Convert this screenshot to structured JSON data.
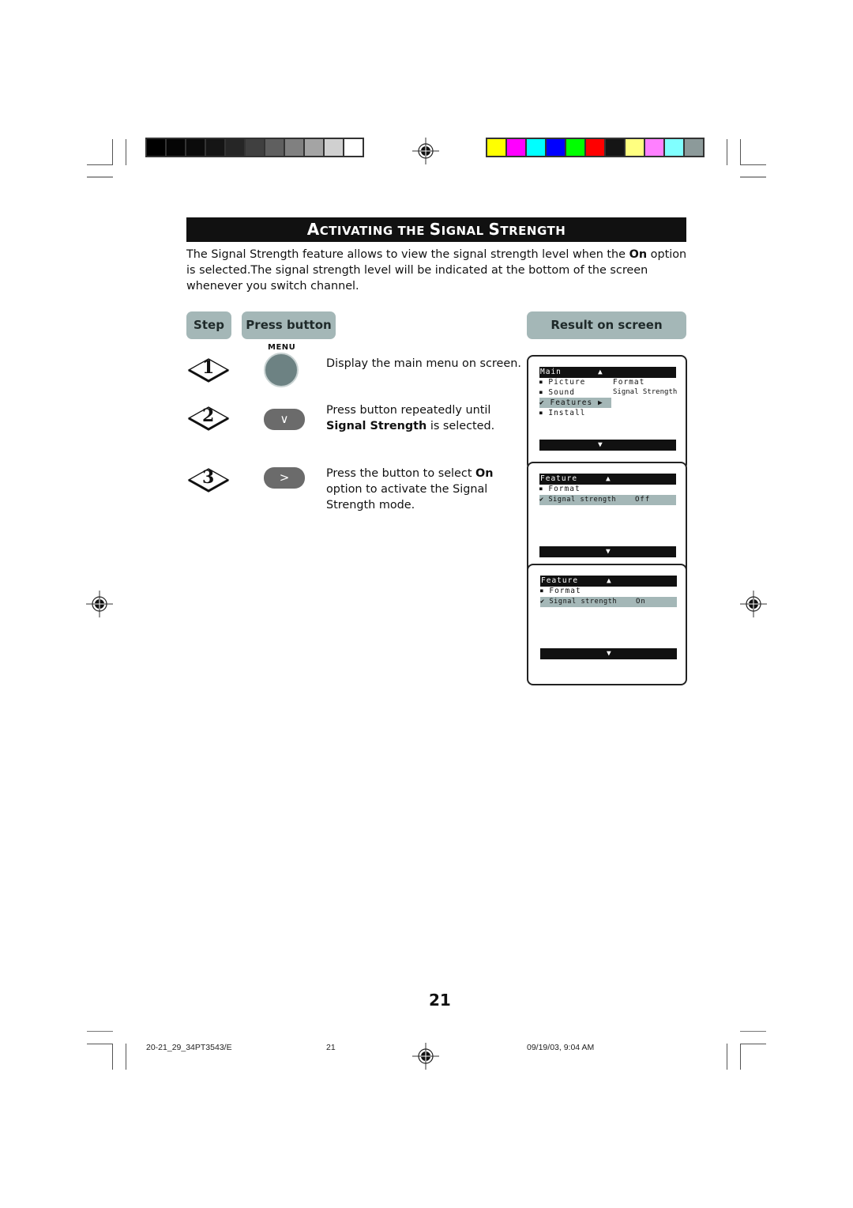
{
  "print_marks": {
    "grayscale_swatches": [
      "#000000",
      "#050505",
      "#0b0b0b",
      "#151515",
      "#262626",
      "#404040",
      "#5f5f5f",
      "#808080",
      "#a4a4a4",
      "#d0d0d0",
      "#ffffff"
    ],
    "color_swatches": [
      "#ffff00",
      "#ff00ff",
      "#00ffff",
      "#0000ff",
      "#00ff00",
      "#ff0000",
      "#151515",
      "#ffff80",
      "#ff80ff",
      "#80ffff",
      "#8c9a9a"
    ]
  },
  "section": {
    "title_parts": [
      {
        "cap": "A",
        "rest": "CTIVATING THE "
      },
      {
        "cap": "S",
        "rest": "IGNAL "
      },
      {
        "cap": "S",
        "rest": "TRENGTH"
      }
    ],
    "intro_before_bold": "The Signal Strength feature allows to view the signal strength level when the ",
    "intro_bold": "On",
    "intro_after_bold": " option is selected.The signal strength level will be indicated at the bottom of the screen whenever you switch channel."
  },
  "table_headers": {
    "step": "Step",
    "press_button": "Press button",
    "result": "Result on screen"
  },
  "steps": [
    {
      "number": "1",
      "button_label": "MENU",
      "button_icon": "menu-round-button",
      "desc_plain": "Display the main menu on screen.",
      "desc_bold": "",
      "desc_after": ""
    },
    {
      "number": "2",
      "button_glyph": "∨",
      "button_icon": "cursor-down-button",
      "desc_plain": "Press button repeatedly until ",
      "desc_bold": "Signal Strength",
      "desc_after": " is selected."
    },
    {
      "number": "3",
      "button_glyph": ">",
      "button_icon": "cursor-right-button",
      "desc_plain": "Press the button to select ",
      "desc_bold": "On",
      "desc_after": " option to activate the Signal Strength mode."
    }
  ],
  "screens": [
    {
      "header": "Main",
      "up_arrow": "▲",
      "down_arrow": "▼",
      "rows": [
        {
          "bullet": "■",
          "label": "Picture",
          "right": "Format"
        },
        {
          "bullet": "■",
          "label": "Sound",
          "right": "Signal Strength"
        },
        {
          "bullet": "✔",
          "label": "Features",
          "arrow": "▶",
          "highlighted": true
        },
        {
          "bullet": "■",
          "label": "Install"
        }
      ]
    },
    {
      "header": "Feature",
      "up_arrow": "▲",
      "down_arrow": "▼",
      "rows": [
        {
          "bullet": "■",
          "label": "Format"
        },
        {
          "bullet": "✔",
          "label": "Signal strength",
          "value": "Off",
          "highlighted": true
        }
      ]
    },
    {
      "header": "Feature",
      "up_arrow": "▲",
      "down_arrow": "▼",
      "rows": [
        {
          "bullet": "■",
          "label": "Format"
        },
        {
          "bullet": "✔",
          "label": "Signal strength",
          "value": "On",
          "highlighted": true
        }
      ]
    }
  ],
  "page_number": "21",
  "footer": {
    "file": "20-21_29_34PT3543/E",
    "page": "21",
    "datetime": "09/19/03, 9:04 AM"
  }
}
